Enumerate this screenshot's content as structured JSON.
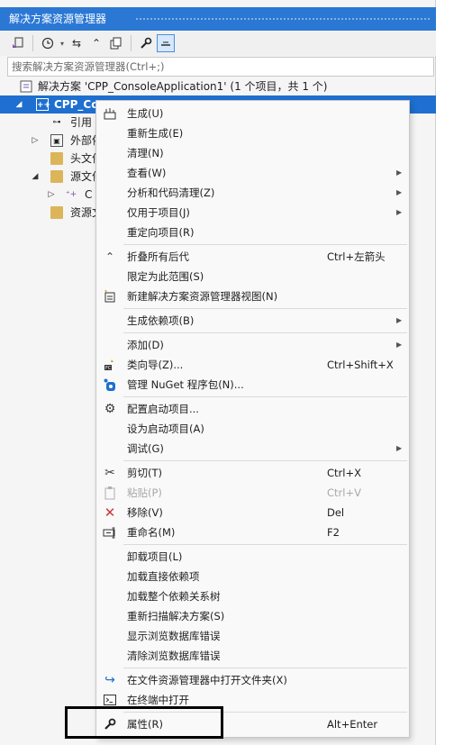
{
  "panel": {
    "title": "解决方案资源管理器",
    "search_placeholder": "搜索解决方案资源管理器(Ctrl+;)"
  },
  "toolbar": {
    "icons": [
      "sync-with-document-icon",
      "history-icon",
      "switch-views-icon",
      "collapse-all-icon",
      "show-all-files-icon",
      "properties-wrench-icon",
      "preview-selected-icon"
    ]
  },
  "tree": {
    "solution": "解决方案 'CPP_ConsoleApplication1' (1 个项目，共 1 个)",
    "project": "CPP_Co",
    "references": "引用",
    "external": "外部依",
    "headers": "头文件",
    "sources": "源文件",
    "source_child": "C",
    "resources": "资源文"
  },
  "menu": {
    "items": [
      {
        "label": "生成(U)",
        "shortcut": "",
        "icon": "build-icon"
      },
      {
        "label": "重新生成(E)",
        "shortcut": ""
      },
      {
        "label": "清理(N)",
        "shortcut": ""
      },
      {
        "label": "查看(W)",
        "shortcut": "",
        "submenu": true
      },
      {
        "label": "分析和代码清理(Z)",
        "shortcut": "",
        "submenu": true
      },
      {
        "label": "仅用于项目(J)",
        "shortcut": "",
        "submenu": true
      },
      {
        "label": "重定向项目(R)",
        "shortcut": ""
      },
      {
        "label": "折叠所有后代",
        "shortcut": "Ctrl+左箭头",
        "icon": "collapse-icon"
      },
      {
        "label": "限定为此范围(S)",
        "shortcut": ""
      },
      {
        "label": "新建解决方案资源管理器视图(N)",
        "shortcut": "",
        "icon": "new-view-icon"
      },
      {
        "label": "生成依赖项(B)",
        "shortcut": "",
        "submenu": true
      },
      {
        "label": "添加(D)",
        "shortcut": "",
        "submenu": true
      },
      {
        "label": "类向导(Z)...",
        "shortcut": "Ctrl+Shift+X",
        "icon": "class-wizard-icon"
      },
      {
        "label": "管理 NuGet 程序包(N)...",
        "shortcut": "",
        "icon": "nuget-icon"
      },
      {
        "label": "配置启动项目...",
        "shortcut": "",
        "icon": "gear-icon"
      },
      {
        "label": "设为启动项目(A)",
        "shortcut": ""
      },
      {
        "label": "调试(G)",
        "shortcut": "",
        "submenu": true
      },
      {
        "label": "剪切(T)",
        "shortcut": "Ctrl+X",
        "icon": "cut-icon"
      },
      {
        "label": "粘贴(P)",
        "shortcut": "Ctrl+V",
        "icon": "paste-icon",
        "disabled": true
      },
      {
        "label": "移除(V)",
        "shortcut": "Del",
        "icon": "remove-icon"
      },
      {
        "label": "重命名(M)",
        "shortcut": "F2",
        "icon": "rename-icon"
      },
      {
        "label": "卸载项目(L)",
        "shortcut": ""
      },
      {
        "label": "加载直接依赖项",
        "shortcut": ""
      },
      {
        "label": "加载整个依赖关系树",
        "shortcut": ""
      },
      {
        "label": "重新扫描解决方案(S)",
        "shortcut": ""
      },
      {
        "label": "显示浏览数据库错误",
        "shortcut": ""
      },
      {
        "label": "清除浏览数据库错误",
        "shortcut": ""
      },
      {
        "label": "在文件资源管理器中打开文件夹(X)",
        "shortcut": "",
        "icon": "open-folder-icon"
      },
      {
        "label": "在终端中打开",
        "shortcut": "",
        "icon": "terminal-icon"
      },
      {
        "label": "属性(R)",
        "shortcut": "Alt+Enter",
        "icon": "wrench-icon"
      }
    ]
  }
}
